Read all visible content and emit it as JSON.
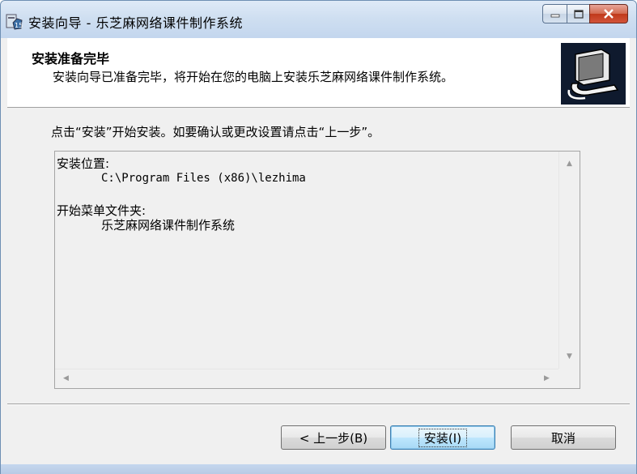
{
  "window": {
    "title": "安装向导 - 乐芝麻网络课件制作系统",
    "controls": {
      "minimize": "▁",
      "maximize": "▢",
      "close": "✕"
    }
  },
  "header": {
    "title": "安装准备完毕",
    "subtitle": "安装向导已准备完毕，将开始在您的电脑上安装乐芝麻网络课件制作系统。",
    "icon": "installer-computer-icon"
  },
  "instruction": "点击“安装”开始安装。如要确认或更改设置请点击“上一步”。",
  "memo": {
    "install_location_label": "安装位置:",
    "install_location_value": "C:\\Program Files (x86)\\lezhima",
    "start_menu_label": "开始菜单文件夹:",
    "start_menu_value": "乐芝麻网络课件制作系统"
  },
  "buttons": {
    "back": "< 上一步(B)",
    "install": "安装(I)",
    "cancel": "取消"
  },
  "colors": {
    "titlebar": "#cfdff1",
    "header_icon_bg": "#0f1a2e",
    "close_button": "#c0391b"
  }
}
